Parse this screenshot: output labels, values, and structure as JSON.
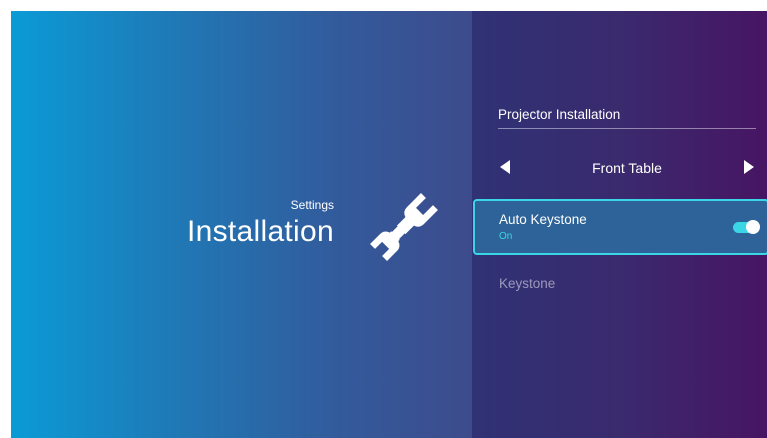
{
  "left_panel": {
    "caption": "Settings",
    "title": "Installation",
    "icon": "wrench-icon"
  },
  "right_panel": {
    "header": "Projector Installation",
    "selector": {
      "value": "Front Table",
      "left_icon": "arrow-left-icon",
      "right_icon": "arrow-right-icon"
    },
    "options": [
      {
        "label": "Auto Keystone",
        "status": "On",
        "toggle_on": true,
        "focused": true
      },
      {
        "label": "Keystone",
        "disabled": true
      }
    ]
  },
  "colors": {
    "accent": "#3ad6e6",
    "left_gradient_start": "#0a9bd6",
    "left_gradient_end": "#3d4b8c",
    "right_gradient_start": "#2f3275",
    "right_gradient_end": "#471563",
    "focused_card": "#2d6398",
    "text": "#ffffff"
  }
}
